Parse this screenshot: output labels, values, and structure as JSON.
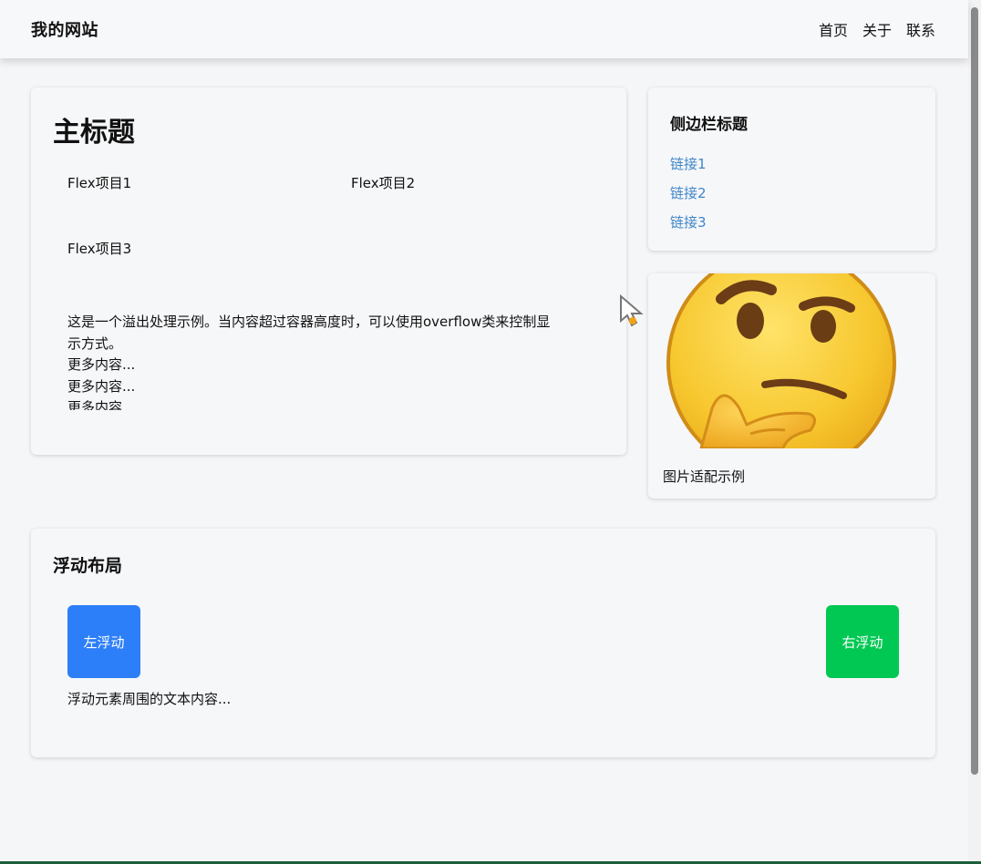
{
  "header": {
    "site_title": "我的网站",
    "nav": [
      "首页",
      "关于",
      "联系"
    ]
  },
  "main": {
    "title": "主标题",
    "flex_items": [
      "Flex项目1",
      "Flex项目2",
      "Flex项目3"
    ],
    "overflow_lines": [
      "这是一个溢出处理示例。当内容超过容器高度时，可以使用overflow类来控制显",
      "示方式。",
      "更多内容...",
      "更多内容...",
      "更多内容..."
    ]
  },
  "sidebar": {
    "title": "侧边栏标题",
    "links": [
      "链接1",
      "链接2",
      "链接3"
    ],
    "link_color": "#3f86c8"
  },
  "image_card": {
    "caption": "图片适配示例",
    "image_icon": "thinking-face-emoji"
  },
  "float_section": {
    "title": "浮动布局",
    "left_label": "左浮动",
    "right_label": "右浮动",
    "left_color": "#2d7ff9",
    "right_color": "#00c853",
    "text": "浮动元素周围的文本内容..."
  }
}
